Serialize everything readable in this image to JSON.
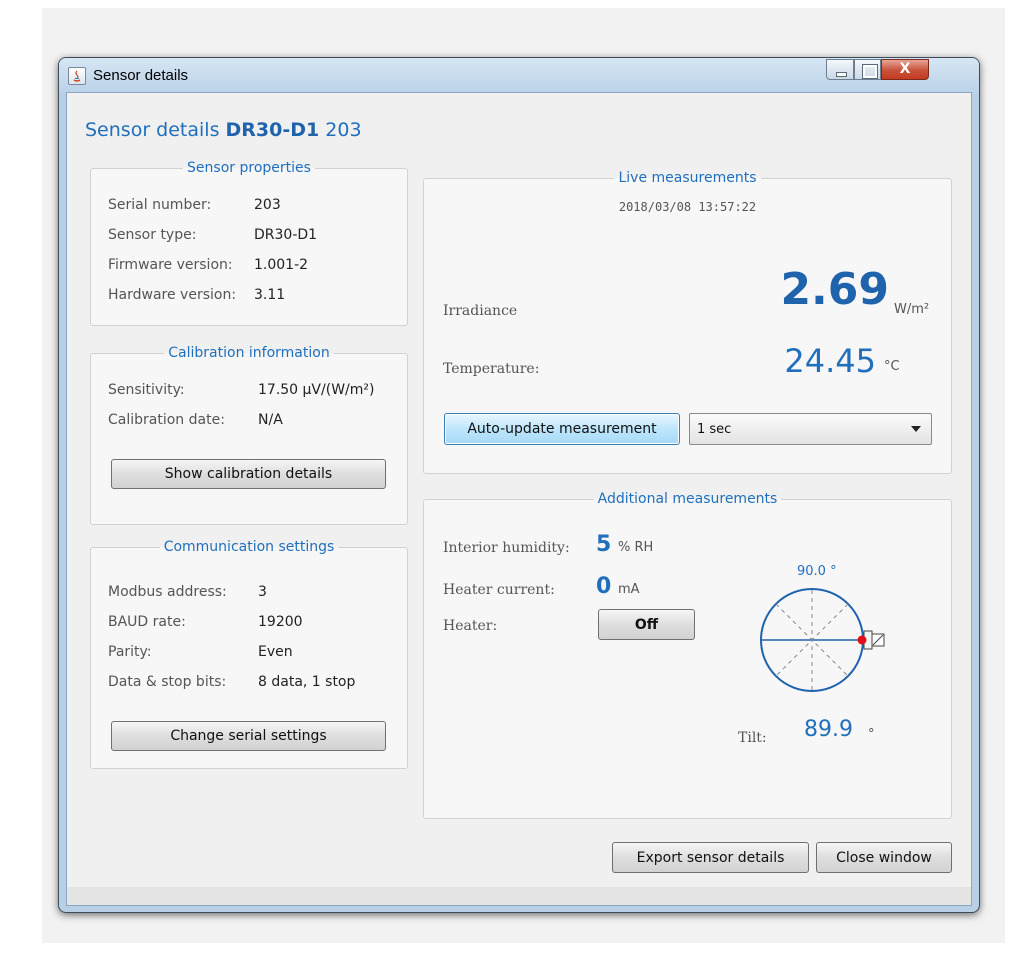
{
  "window": {
    "title": "Sensor details",
    "controls": {
      "close_glyph": "X"
    }
  },
  "heading": {
    "prefix": "Sensor details",
    "model": "DR30-D1",
    "serial": "203"
  },
  "sensor_properties": {
    "legend": "Sensor properties",
    "rows": [
      {
        "label": "Serial number:",
        "value": "203"
      },
      {
        "label": "Sensor type:",
        "value": "DR30-D1"
      },
      {
        "label": "Firmware version:",
        "value": "1.001-2"
      },
      {
        "label": "Hardware version:",
        "value": "3.11"
      }
    ]
  },
  "calibration": {
    "legend": "Calibration information",
    "rows": [
      {
        "label": "Sensitivity:",
        "value": "17.50 µV/(W/m²)"
      },
      {
        "label": "Calibration date:",
        "value": "N/A"
      }
    ],
    "button_label": "Show calibration details"
  },
  "communication": {
    "legend": "Communication settings",
    "rows": [
      {
        "label": "Modbus address:",
        "value": "3"
      },
      {
        "label": "BAUD rate:",
        "value": "19200"
      },
      {
        "label": "Parity:",
        "value": "Even"
      },
      {
        "label": "Data & stop bits:",
        "value": "8 data, 1 stop"
      }
    ],
    "button_label": "Change serial settings"
  },
  "live": {
    "legend": "Live measurements",
    "timestamp": "2018/03/08 13:57:22",
    "irradiance": {
      "label": "Irradiance",
      "value": "2.69",
      "unit": "W/m²"
    },
    "temperature": {
      "label": "Temperature:",
      "value": "24.45",
      "unit": "°C"
    },
    "auto_update_label": "Auto-update measurement",
    "interval": "1 sec"
  },
  "additional": {
    "legend": "Additional measurements",
    "humidity": {
      "label": "Interior humidity:",
      "value": "5",
      "unit": "% RH"
    },
    "heater_current": {
      "label": "Heater current:",
      "value": "0",
      "unit": "mA"
    },
    "heater": {
      "label": "Heater:",
      "button_label": "Off"
    },
    "tilt": {
      "label": "Tilt:",
      "value": "89.9",
      "unit": "°",
      "gauge_label": "90.0 °"
    }
  },
  "footer": {
    "export_label": "Export sensor details",
    "close_label": "Close window"
  },
  "colors": {
    "accent": "#1f6fbd",
    "indicator": "#e0101a"
  }
}
